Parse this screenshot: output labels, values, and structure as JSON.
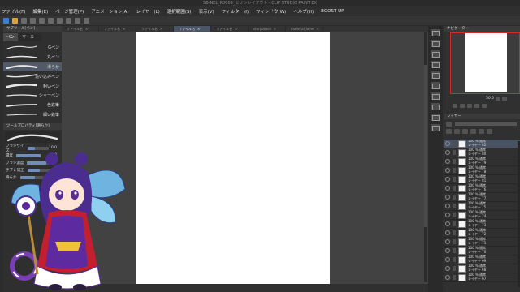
{
  "window_title": "SB-NEL_R0000_セリンレイアウト - CLIP STUDIO PAINT EX",
  "menu": [
    "ファイル(F)",
    "編集(E)",
    "ページ管理(P)",
    "アニメーション(A)",
    "レイヤー(L)",
    "選択範囲(S)",
    "表示(V)",
    "フィルター(I)",
    "ウィンドウ(W)",
    "ヘルプ(H)",
    "BOOST UP"
  ],
  "subtool": {
    "header": "サブツール[ペン]",
    "tabs": [
      "ペン",
      "マーカー"
    ],
    "brushes": [
      {
        "label": "Gペン",
        "selected": false
      },
      {
        "label": "丸ペン",
        "selected": false
      },
      {
        "label": "滑らか",
        "selected": true
      },
      {
        "label": "追い込みペン",
        "selected": false
      },
      {
        "label": "粗いペン",
        "selected": false
      },
      {
        "label": "シャーペン",
        "selected": false
      },
      {
        "label": "色鉄筆",
        "selected": false
      },
      {
        "label": "細い鉄筆",
        "selected": false
      }
    ]
  },
  "tool_property": {
    "header": "ツールプロパティ[滑らか]",
    "rows": [
      {
        "label": "ブラシサイズ",
        "value": "10.0",
        "level": 0.35
      },
      {
        "label": "濃度",
        "value": "100",
        "level": 1.0
      },
      {
        "label": "ブラシ濃度",
        "value": "",
        "level": 0.8
      },
      {
        "label": "手ブレ補正",
        "value": "",
        "level": 0.5
      },
      {
        "label": "滑らか",
        "value": "",
        "level": 0.6
      }
    ]
  },
  "document_tabs": [
    {
      "label": "ファイル名",
      "active": false
    },
    {
      "label": "ファイル名",
      "active": false
    },
    {
      "label": "ファイル名",
      "active": false
    },
    {
      "label": "ファイル名",
      "active": true
    },
    {
      "label": "ファイル名",
      "active": false
    },
    {
      "label": "storyboard",
      "active": false
    },
    {
      "label": "material_layer",
      "active": false
    }
  ],
  "status": {
    "zoom": "50.0",
    "angle": "0.0"
  },
  "navigator": {
    "title": "ナビゲーター",
    "zoom": "50.0"
  },
  "layer_panel": {
    "title": "レイヤー",
    "layers": [
      {
        "mode": "100 % 通常",
        "name": "レイヤー 82",
        "selected": true
      },
      {
        "mode": "100 % 通常",
        "name": "レイヤー 80",
        "selected": false
      },
      {
        "mode": "100 % 通常",
        "name": "レイヤー 79",
        "selected": false
      },
      {
        "mode": "100 % 通常",
        "name": "レイヤー 78",
        "selected": false
      },
      {
        "mode": "100 % 通常",
        "name": "レイヤー 81",
        "selected": false
      },
      {
        "mode": "100 % 通常",
        "name": "レイヤー 76",
        "selected": false
      },
      {
        "mode": "100 % 通常",
        "name": "レイヤー 77",
        "selected": false
      },
      {
        "mode": "100 % 通常",
        "name": "レイヤー 75",
        "selected": false
      },
      {
        "mode": "100 % 通常",
        "name": "レイヤー 74",
        "selected": false
      },
      {
        "mode": "100 % 通常",
        "name": "レイヤー 73",
        "selected": false
      },
      {
        "mode": "100 % 通常",
        "name": "レイヤー 72",
        "selected": false
      },
      {
        "mode": "100 % 通常",
        "name": "レイヤー 71",
        "selected": false
      },
      {
        "mode": "100 % 通常",
        "name": "レイヤー 70",
        "selected": false
      },
      {
        "mode": "100 % 通常",
        "name": "レイヤー 69",
        "selected": false
      },
      {
        "mode": "100 % 通常",
        "name": "レイヤー 68",
        "selected": false
      },
      {
        "mode": "100 % 通常",
        "name": "レイヤー 67",
        "selected": false
      }
    ]
  },
  "colors": {
    "accent": "#4c5565",
    "navigator_frame": "#d12b2b",
    "selection": "#505a68"
  }
}
